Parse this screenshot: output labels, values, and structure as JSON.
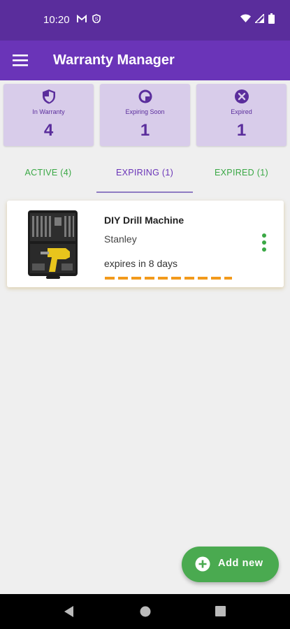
{
  "status_bar": {
    "time": "10:20"
  },
  "app_bar": {
    "title": "Warranty Manager"
  },
  "stats": [
    {
      "label": "In Warranty",
      "count": "4",
      "icon": "shield-icon"
    },
    {
      "label": "Expiring Soon",
      "count": "1",
      "icon": "clock-icon"
    },
    {
      "label": "Expired",
      "count": "1",
      "icon": "cancel-icon"
    }
  ],
  "tabs": [
    {
      "label": "ACTIVE (4)"
    },
    {
      "label": "EXPIRING (1)",
      "selected": true
    },
    {
      "label": "EXPIRED (1)"
    }
  ],
  "items": [
    {
      "name": "DIY Drill Machine",
      "brand": "Stanley",
      "expiry": "expires in 8 days"
    }
  ],
  "fab": {
    "label": "Add new"
  },
  "colors": {
    "primary": "#6a34b8",
    "status_bar": "#5a2d9c",
    "accent_green": "#3aa845",
    "expiry_orange": "#f29a1c",
    "card_purple": "#d8ccea"
  }
}
